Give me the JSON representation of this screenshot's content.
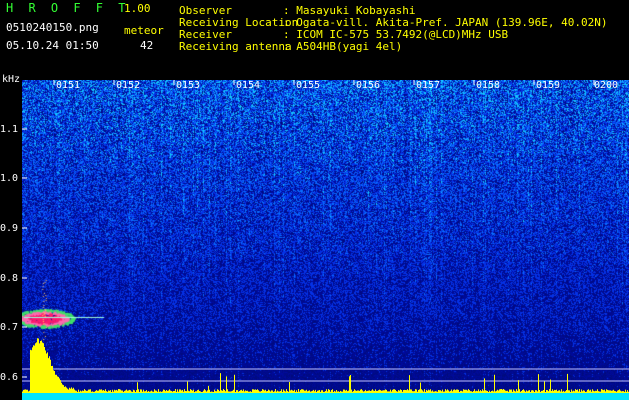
{
  "header": {
    "app_title": "H R O F F T",
    "app_version": "1.00",
    "file_name": "0510240150.png",
    "meteor_label": "meteor",
    "meteor_count": "42",
    "datetime": "05.10.24 01:50",
    "info": [
      {
        "label": "Observer",
        "value": ": Masayuki Kobayashi"
      },
      {
        "label": "Receiving Location",
        "value": ": Ogata-vill. Akita-Pref. JAPAN (139.96E, 40.02N)"
      },
      {
        "label": "Receiver",
        "value": ": ICOM IC-575 53.7492(@LCD)MHz USB"
      },
      {
        "label": "Receiving antenna",
        "value": ": A504HB(yagi 4el)"
      }
    ]
  },
  "axis": {
    "y_unit": "kHz",
    "y_ticks": [
      "1.1",
      "1.0",
      "0.9",
      "0.8",
      "0.7",
      "0.6"
    ],
    "x_ticks": [
      "0151",
      "0152",
      "0153",
      "0154",
      "0155",
      "0156",
      "0157",
      "0158",
      "0159",
      "0200"
    ]
  },
  "colors": {
    "background": "#000000",
    "noise_dark": "#000a80",
    "noise_mid": "#0a2fe0",
    "noise_bright": "#1ea8ff",
    "echo": "#ff1a6e",
    "amplitude": "#ffff00",
    "baseline": "#00e5ff",
    "text_yellow": "#ffff00",
    "text_white": "#ffffff"
  }
}
